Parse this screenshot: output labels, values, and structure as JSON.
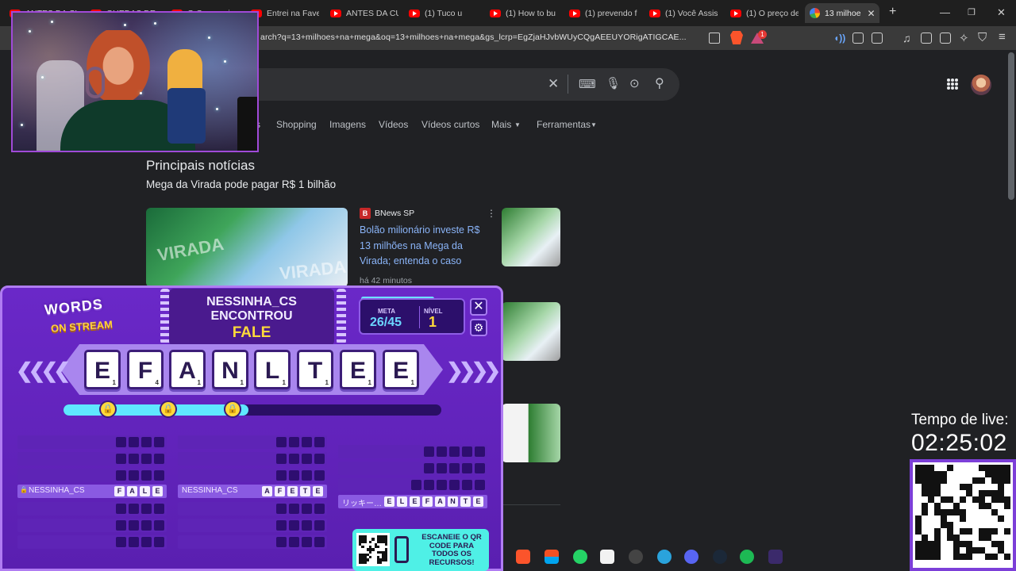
{
  "browser": {
    "tabs": [
      {
        "label": "ANTES DA CU",
        "icon": "youtube-icon"
      },
      {
        "label": "QUEDAS DE A",
        "icon": "youtube-icon"
      },
      {
        "label": "O Cara mais",
        "icon": "youtube-icon"
      },
      {
        "label": "Entrei na Fave",
        "icon": "youtube-icon"
      },
      {
        "label": "ANTES DA CU",
        "icon": "youtube-icon"
      },
      {
        "label": "(1) Tuco u",
        "icon": "youtube-icon"
      },
      {
        "label": "(1) How to bu",
        "icon": "youtube-icon"
      },
      {
        "label": "(1) prevendo f",
        "icon": "youtube-icon"
      },
      {
        "label": "(1) Você Assis",
        "icon": "youtube-icon"
      },
      {
        "label": "(1) O preço de",
        "icon": "youtube-icon"
      },
      {
        "label": "13 milhoe",
        "icon": "google-icon",
        "active": true
      }
    ],
    "url": "arch?q=13+milhoes+na+mega&oq=13+milhoes+na+mega&gs_lcrp=EgZjaHJvbWUyCQgAEEUYORigATIGCAE...",
    "brave_badge": "1"
  },
  "google": {
    "tabs": [
      "s",
      "Shopping",
      "Imagens",
      "Vídeos",
      "Vídeos curtos",
      "Mais",
      "Ferramentas"
    ],
    "section_title": "Principais notícias",
    "subheading": "Mega da Virada pode pagar R$ 1 bilhão",
    "news": {
      "source": "BNews SP",
      "title": "Bolão milionário investe R$ 13 milhões na Mega da Virada; entenda o caso",
      "time": "há 42 minutos"
    }
  },
  "game": {
    "logo_line1": "WORDS",
    "logo_line2": "ON STREAM",
    "found_by": "NESSINHA_CS",
    "found_verb": "ENCONTROU",
    "found_word": "FALE",
    "meta_label": "META",
    "meta_value": "26/45",
    "nivel_label": "NÍVEL",
    "nivel_value": "1",
    "progress": 0.49,
    "letters": [
      {
        "ch": "E",
        "score": "1"
      },
      {
        "ch": "F",
        "score": "4"
      },
      {
        "ch": "A",
        "score": "1"
      },
      {
        "ch": "N",
        "score": "1"
      },
      {
        "ch": "L",
        "score": "1"
      },
      {
        "ch": "T",
        "score": "1"
      },
      {
        "ch": "E",
        "score": "1"
      },
      {
        "ch": "E",
        "score": "1"
      }
    ],
    "found_words": [
      {
        "name": "NESSINHA_CS",
        "word": [
          "F",
          "A",
          "L",
          "E"
        ]
      },
      {
        "name": "NESSINHA_CS",
        "word": [
          "A",
          "F",
          "E",
          "T",
          "E"
        ]
      },
      {
        "name": "リッキー…",
        "word": [
          "E",
          "L",
          "E",
          "F",
          "A",
          "N",
          "T",
          "E"
        ]
      }
    ],
    "qr_promo": "ESCANEIE O QR CODE PARA TODOS OS RECURSOS!"
  },
  "stream": {
    "timer_label": "Tempo de live:",
    "timer": "02:25:02"
  }
}
